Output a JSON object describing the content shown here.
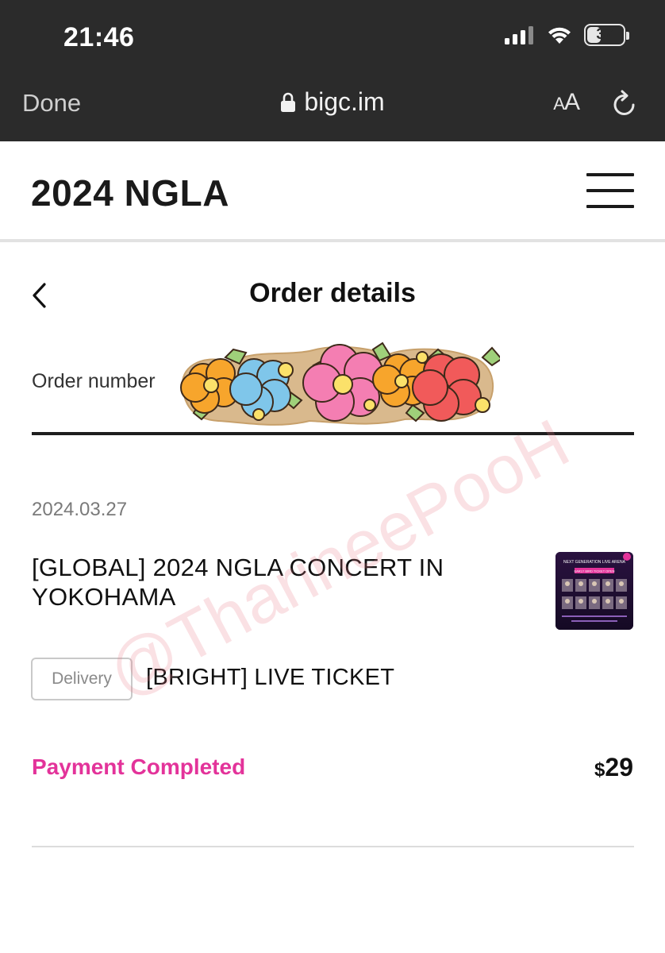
{
  "status_bar": {
    "time": "21:46",
    "battery_level": "37"
  },
  "browser": {
    "done_label": "Done",
    "url": "bigc.im",
    "text_size_label_small": "A",
    "text_size_label_large": "A"
  },
  "site": {
    "title": "2024 NGLA"
  },
  "page": {
    "title": "Order details",
    "order_number_label": "Order number"
  },
  "order": {
    "date": "2024.03.27",
    "product_name": "[GLOBAL] 2024 NGLA CONCERT IN YOKOHAMA",
    "delivery_badge": "Delivery",
    "option_name": "[BRIGHT] LIVE TICKET",
    "payment_status": "Payment Completed",
    "currency": "$",
    "price": "29"
  },
  "thumbnail": {
    "headline": "NEXT GENERATION LIVE ARENA",
    "banner": "EARLY BIRD TICKET OPEN"
  },
  "watermark": "@TharineePooH",
  "colors": {
    "chrome_bg": "#2b2b2b",
    "accent_pink": "#e3339a",
    "divider_dark": "#1e1e1e",
    "divider_light": "#dcdcdc"
  }
}
